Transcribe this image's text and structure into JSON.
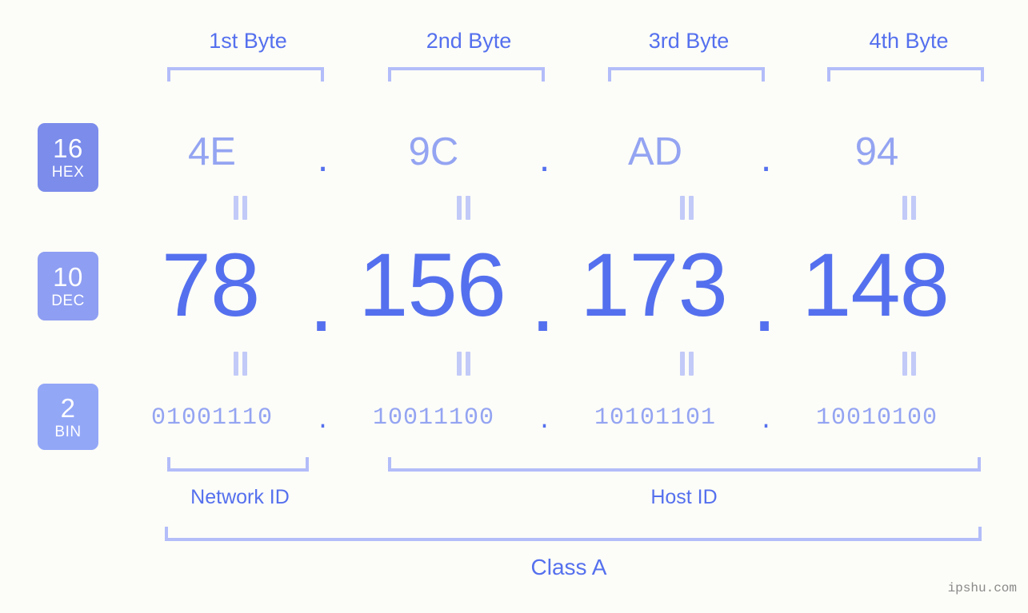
{
  "background_color": "#fcfdf8",
  "accent_color": "#5570ee",
  "accent_light_color": "#94a4f2",
  "bracket_color": "#b3bdf9",
  "byte_headers": [
    {
      "label": "1st Byte"
    },
    {
      "label": "2nd Byte"
    },
    {
      "label": "3rd Byte"
    },
    {
      "label": "4th Byte"
    }
  ],
  "radix_rows": [
    {
      "badge_number": "16",
      "badge_abbr": "HEX",
      "badge_color": "#7b8ceb",
      "values": [
        "4E",
        "9C",
        "AD",
        "94"
      ],
      "separator": "."
    },
    {
      "badge_number": "10",
      "badge_abbr": "DEC",
      "badge_color": "#8e9ef2",
      "values": [
        "78",
        "156",
        "173",
        "148"
      ],
      "separator": "."
    },
    {
      "badge_number": "2",
      "badge_abbr": "BIN",
      "badge_color": "#93a7f7",
      "values": [
        "01001110",
        "10011100",
        "10101101",
        "10010100"
      ],
      "separator": "."
    }
  ],
  "equality_symbol": "=",
  "sections": {
    "network_id": "Network ID",
    "host_id": "Host ID",
    "class": "Class A"
  },
  "watermark": "ipshu.com"
}
